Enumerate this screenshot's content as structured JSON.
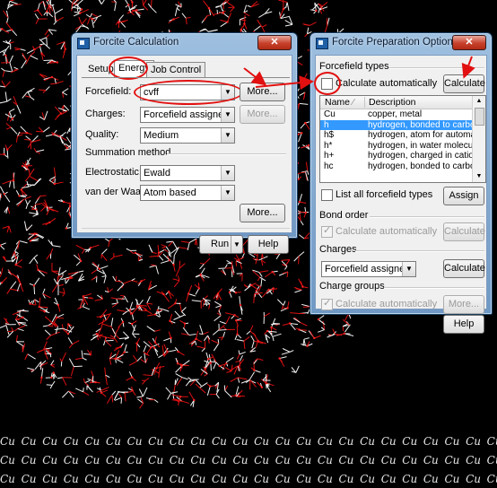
{
  "forcite_calc": {
    "title": "Forcite Calculation",
    "close": "✕",
    "tabs": [
      "Setup",
      "Energy",
      "Job Control"
    ],
    "forcefield_label": "Forcefield:",
    "forcefield_value": "cvff",
    "forcefield_more": "More...",
    "charges_label": "Charges:",
    "charges_value": "Forcefield assigned",
    "charges_more": "More...",
    "quality_label": "Quality:",
    "quality_value": "Medium",
    "summation_header": "Summation method",
    "electrostatic_label": "Electrostatic:",
    "electrostatic_value": "Ewald",
    "vdw_label": "van der Waals:",
    "vdw_value": "Atom based",
    "summation_more": "More...",
    "run_label": "Run",
    "help_label": "Help"
  },
  "prep_options": {
    "title": "Forcite Preparation Options",
    "close": "✕",
    "forcefield_types_header": "Forcefield types",
    "calc_auto_label": "Calculate automatically",
    "calculate_label": "Calculate",
    "list_headers": [
      "Name",
      "Description"
    ],
    "list_rows": [
      [
        "Cu",
        "copper, metal"
      ],
      [
        "h",
        "hydrogen, bonded to carbon, ..."
      ],
      [
        "h$",
        "hydrogen, atom for automatic ..."
      ],
      [
        "h*",
        "hydrogen, in water molecule"
      ],
      [
        "h+",
        "hydrogen, charged  in cations"
      ],
      [
        "hc",
        "hydrogen, bonded to carbon, ..."
      ]
    ],
    "list_all_label": "List all forcefield types",
    "assign_label": "Assign",
    "bond_order_header": "Bond order",
    "bond_calc_auto_label": "Calculate automatically",
    "bond_calculate_label": "Calculate",
    "charges_header": "Charges",
    "charges_value": "Forcefield assigned",
    "charges_calculate_label": "Calculate",
    "charge_groups_header": "Charge groups",
    "cg_calc_auto_label": "Calculate automatically",
    "cg_more_label": "More...",
    "help_label": "Help"
  },
  "background": {
    "cu_label": "Cu"
  },
  "colors": {
    "annotation": "#e21010",
    "selection": "#3399ff"
  }
}
